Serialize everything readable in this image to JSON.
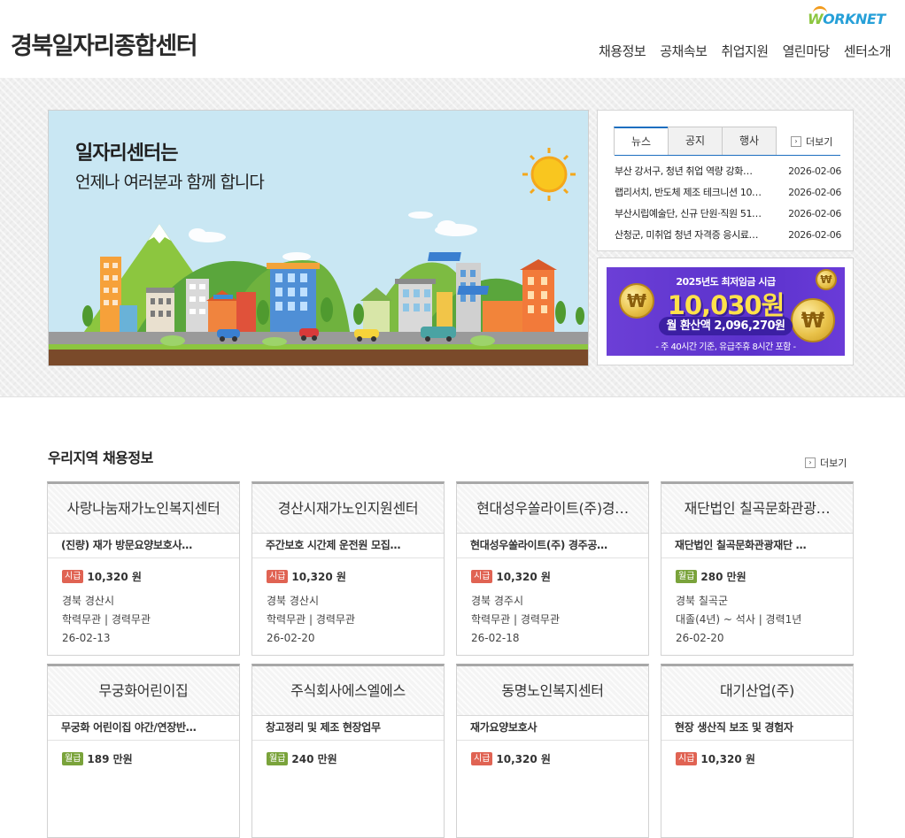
{
  "header": {
    "title": "경북일자리종합센터",
    "logo_text": "ORKNET",
    "logo_w": "W",
    "nav": [
      "채용정보",
      "공채속보",
      "취업지원",
      "열린마당",
      "센터소개"
    ]
  },
  "banner": {
    "line1": "일자리센터는",
    "line2": "언제나 여러분과 함께 합니다"
  },
  "news": {
    "tabs": [
      "뉴스",
      "공지",
      "행사"
    ],
    "more": "더보기",
    "items": [
      {
        "title": "부산 강서구, 청년 취업 역량 강화…",
        "date": "2026-02-06"
      },
      {
        "title": "랩리서치, 반도체 제조 테크니션 10…",
        "date": "2026-02-06"
      },
      {
        "title": "부산시립예술단, 신규 단원·직원 51…",
        "date": "2026-02-06"
      },
      {
        "title": "산청군, 미취업 청년 자격증 응시료…",
        "date": "2026-02-06"
      }
    ]
  },
  "wage_banner": {
    "top": "2025년도 최저임금 시급",
    "amount": "10,030원",
    "monthly": "월 환산액 2,096,270원",
    "note": "- 주 40시간 기준, 유급주휴 8시간 포함 -",
    "coin_symbol": "₩",
    "colors": {
      "background": "#5b32cc",
      "amount": "#ffe14a"
    }
  },
  "jobs": {
    "title": "우리지역 채용정보",
    "more": "더보기",
    "cards": [
      {
        "company": "사랑나눔재가노인복지센터",
        "post": "(진량) 재가 방문요양보호사…",
        "pay_type": "시급",
        "pay_kind": "hourly",
        "pay": "10,320 원",
        "location": "경북 경산시",
        "req": "학력무관 | 경력무관",
        "date": "26-02-13"
      },
      {
        "company": "경산시재가노인지원센터",
        "post": "주간보호 시간제 운전원 모집…",
        "pay_type": "시급",
        "pay_kind": "hourly",
        "pay": "10,320 원",
        "location": "경북 경산시",
        "req": "학력무관 | 경력무관",
        "date": "26-02-20"
      },
      {
        "company": "현대성우쏠라이트(주)경…",
        "post": "현대성우쏠라이트(주) 경주공…",
        "pay_type": "시급",
        "pay_kind": "hourly",
        "pay": "10,320 원",
        "location": "경북 경주시",
        "req": "학력무관 | 경력무관",
        "date": "26-02-18"
      },
      {
        "company": "재단법인 칠곡문화관광…",
        "post": "재단법인 칠곡문화관광재단 …",
        "pay_type": "월급",
        "pay_kind": "monthly",
        "pay": "280 만원",
        "location": "경북 칠곡군",
        "req": "대졸(4년) ~ 석사 | 경력1년",
        "date": "26-02-20"
      },
      {
        "company": "무궁화어린이집",
        "post": "무궁화 어린이집 야간/연장반…",
        "pay_type": "월급",
        "pay_kind": "monthly",
        "pay": "189 만원",
        "location": "",
        "req": "",
        "date": ""
      },
      {
        "company": "주식회사에스엘에스",
        "post": "창고정리 및 제조 현장업무",
        "pay_type": "월급",
        "pay_kind": "monthly",
        "pay": "240 만원",
        "location": "",
        "req": "",
        "date": ""
      },
      {
        "company": "동명노인복지센터",
        "post": "재가요양보호사",
        "pay_type": "시급",
        "pay_kind": "hourly",
        "pay": "10,320 원",
        "location": "",
        "req": "",
        "date": ""
      },
      {
        "company": "대기산업(주)",
        "post": "현장 생산직 보조 및 경험자",
        "pay_type": "시급",
        "pay_kind": "hourly",
        "pay": "10,320 원",
        "location": "",
        "req": "",
        "date": ""
      }
    ]
  }
}
